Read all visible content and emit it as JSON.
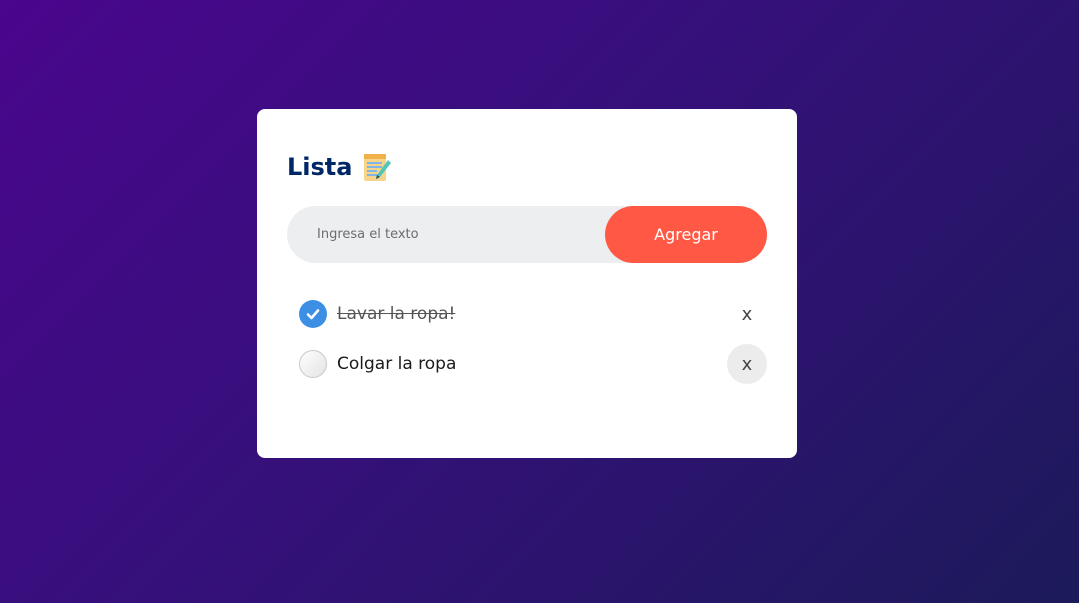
{
  "app": {
    "title": "Lista",
    "title_icon": "notepad-icon"
  },
  "input": {
    "placeholder": "Ingresa el texto",
    "value": ""
  },
  "add_button": {
    "label": "Agregar"
  },
  "tasks": [
    {
      "text": "Lavar la ropa!",
      "done": true,
      "delete_label": "x"
    },
    {
      "text": "Colgar la ropa",
      "done": false,
      "delete_label": "x"
    }
  ],
  "colors": {
    "accent": "#ff5945",
    "title": "#002765",
    "check": "#3d8fe6",
    "input_bg": "#edeef0"
  }
}
